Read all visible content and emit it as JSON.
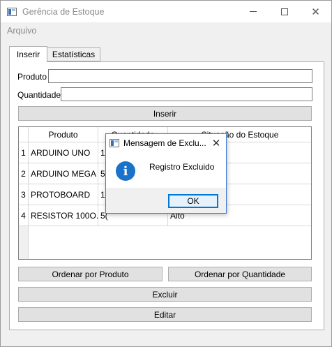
{
  "window": {
    "title": "Gerência de Estoque",
    "controls": {
      "minimize_icon": "minimize-icon",
      "maximize_icon": "maximize-icon",
      "close_icon": "close-icon",
      "close_glyph": "✕"
    }
  },
  "menubar": {
    "items": [
      {
        "label": "Arquivo"
      }
    ]
  },
  "tabs": [
    {
      "label": "Inserir",
      "active": true
    },
    {
      "label": "Estatísticas",
      "active": false
    }
  ],
  "form": {
    "produto_label": "Produto",
    "produto_value": "",
    "quantidade_label": "Quantidade",
    "quantidade_value": "",
    "insert_button": "Inserir"
  },
  "table": {
    "headers": [
      "Produto",
      "Quantidade",
      "Situação do Estoque"
    ],
    "rows": [
      {
        "num": "1",
        "produto": "ARDUINO UNO",
        "quantidade": "1(",
        "situacao": ""
      },
      {
        "num": "2",
        "produto": "ARDUINO MEGA",
        "quantidade": "5(",
        "situacao": ""
      },
      {
        "num": "3",
        "produto": "PROTOBOARD",
        "quantidade": "1(",
        "situacao": ""
      },
      {
        "num": "4",
        "produto": "RESISTOR 100O...",
        "quantidade": "5(",
        "situacao": "Alto"
      }
    ]
  },
  "buttons": {
    "sort_produto": "Ordenar por Produto",
    "sort_quantidade": "Ordenar por Quantidade",
    "excluir": "Excluir",
    "editar": "Editar"
  },
  "dialog": {
    "title": "Mensagem de Exclu...",
    "close_glyph": "✕",
    "icon": "info-icon",
    "icon_glyph": "i",
    "message": "Registro Excluido",
    "ok_label": "OK"
  },
  "colors": {
    "accent": "#0078d7",
    "info_icon": "#1a72c9",
    "button_face": "#e1e1e1"
  }
}
